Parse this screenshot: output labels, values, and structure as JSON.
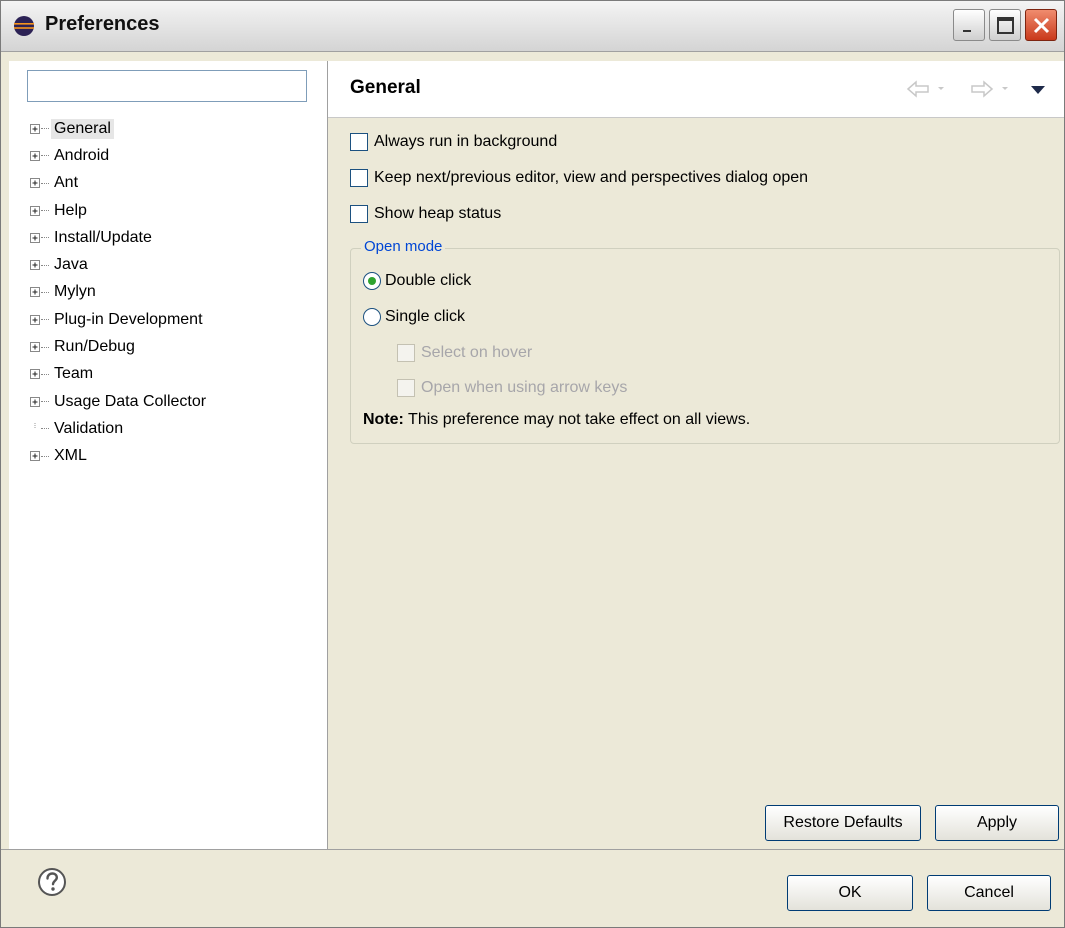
{
  "window": {
    "title": "Preferences"
  },
  "filter": {
    "placeholder": "",
    "value": ""
  },
  "tree": {
    "items": [
      {
        "label": "General",
        "expandable": true,
        "selected": true
      },
      {
        "label": "Android",
        "expandable": true
      },
      {
        "label": "Ant",
        "expandable": true
      },
      {
        "label": "Help",
        "expandable": true
      },
      {
        "label": "Install/Update",
        "expandable": true
      },
      {
        "label": "Java",
        "expandable": true
      },
      {
        "label": "Mylyn",
        "expandable": true
      },
      {
        "label": "Plug-in Development",
        "expandable": true
      },
      {
        "label": "Run/Debug",
        "expandable": true
      },
      {
        "label": "Team",
        "expandable": true
      },
      {
        "label": "Usage Data Collector",
        "expandable": true
      },
      {
        "label": "Validation",
        "expandable": false
      },
      {
        "label": "XML",
        "expandable": true
      }
    ]
  },
  "page": {
    "title": "General",
    "checkboxes": {
      "always_run_background": "Always run in background",
      "keep_dialog_open": "Keep next/previous editor, view and perspectives dialog open",
      "show_heap_status": "Show heap status"
    },
    "open_mode": {
      "label": "Open mode",
      "double_click": "Double click",
      "single_click": "Single click",
      "select_on_hover": "Select on hover",
      "open_arrow_keys": "Open when using arrow keys",
      "note_bold": "Note:",
      "note_text": " This preference may not take effect on all views.",
      "selected": "Double click"
    }
  },
  "buttons": {
    "restore_defaults": "Restore Defaults",
    "apply": "Apply",
    "ok": "OK",
    "cancel": "Cancel"
  },
  "colors": {
    "group_label": "#0046d5",
    "radio_dot": "#2fa32f",
    "close_button": "#c9391b"
  },
  "icons": {
    "app": "eclipse-icon",
    "back": "back-arrow-icon",
    "forward": "forward-arrow-icon",
    "menu": "view-menu-icon",
    "help": "help-icon"
  }
}
